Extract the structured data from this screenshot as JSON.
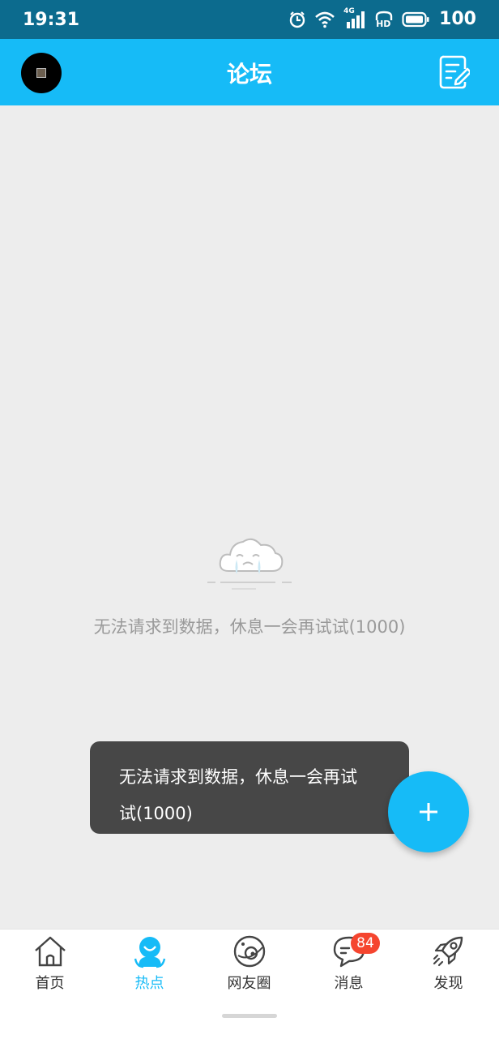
{
  "status_bar": {
    "time": "19:31",
    "network_label": "4G",
    "hd_label": "HD",
    "battery": "100",
    "icons": [
      "alarm-icon",
      "wifi-icon",
      "signal-icon",
      "hd-icon",
      "battery-icon"
    ]
  },
  "header": {
    "title": "论坛",
    "left_icon": "avatar",
    "right_icon": "compose-icon",
    "background_color": "#16bbf7"
  },
  "empty_state": {
    "icon": "crying-cloud-icon",
    "message": "无法请求到数据，休息一会再试试(1000)"
  },
  "toast": {
    "line1": "无法请求到数据，休息一会再试",
    "line2": "试(1000)"
  },
  "fab": {
    "icon": "plus-icon"
  },
  "bottom_nav": {
    "items": [
      {
        "label": "首页",
        "icon": "home-icon",
        "active": false
      },
      {
        "label": "热点",
        "icon": "hot-person-icon",
        "active": true
      },
      {
        "label": "网友圈",
        "icon": "planet-icon",
        "active": false
      },
      {
        "label": "消息",
        "icon": "message-icon",
        "active": false,
        "badge": "84"
      },
      {
        "label": "发现",
        "icon": "rocket-icon",
        "active": false
      }
    ],
    "active_color": "#16bbf7",
    "badge_color": "#f5452f"
  }
}
